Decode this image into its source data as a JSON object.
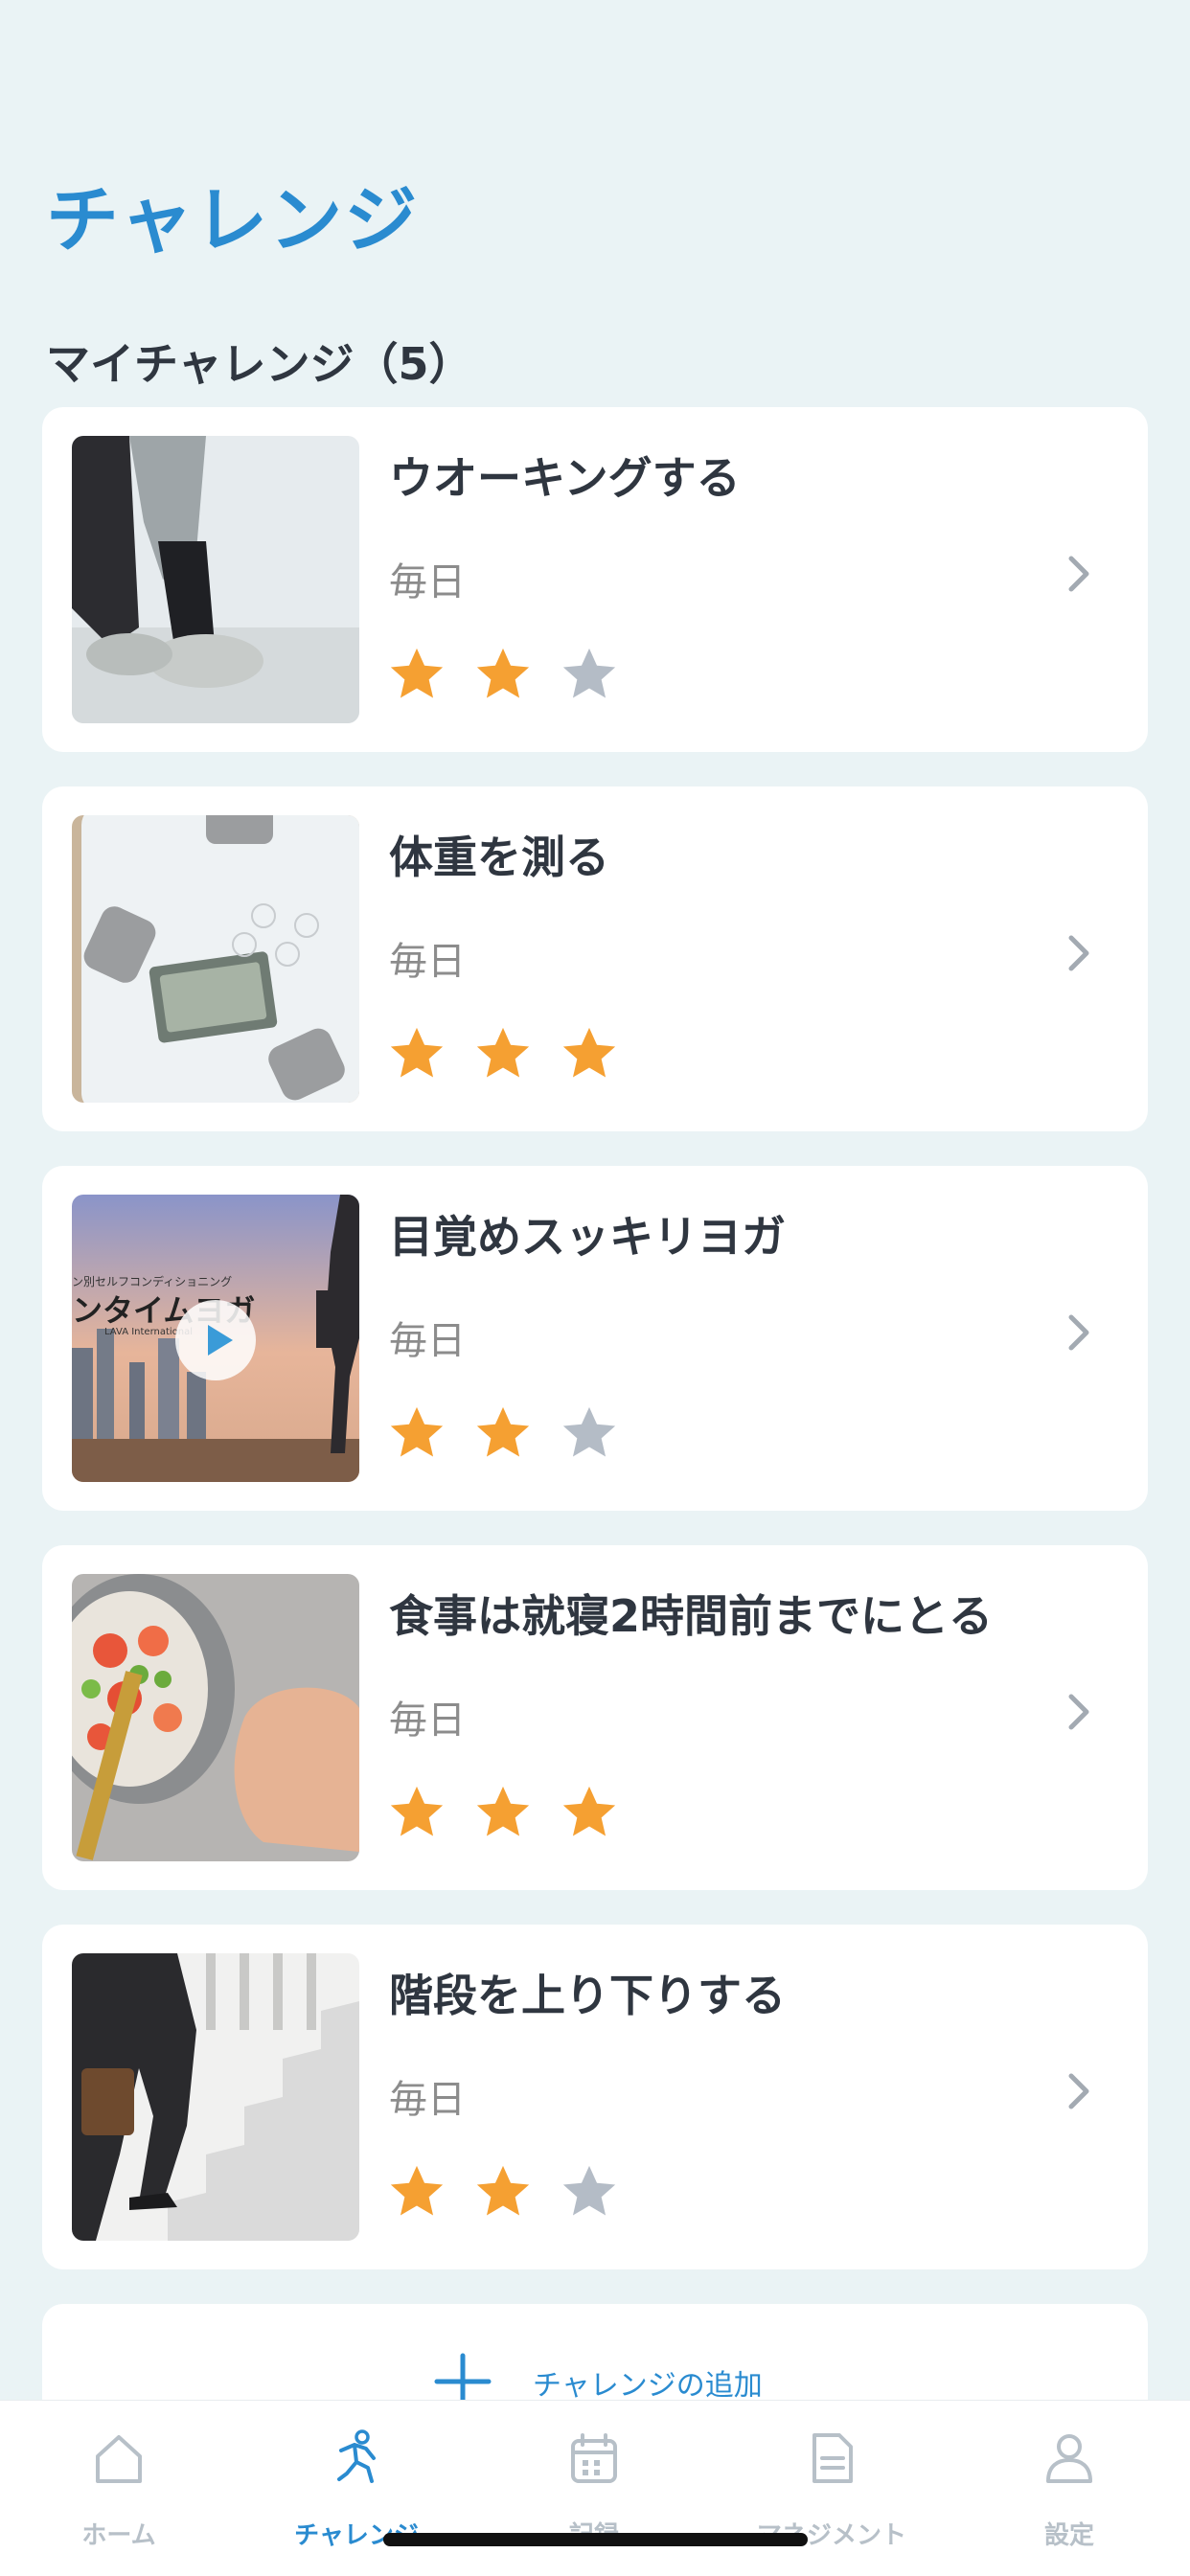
{
  "page": {
    "title": "チャレンジ"
  },
  "section": {
    "title": "マイチャレンジ（5）"
  },
  "challenges": [
    {
      "title": "ウオーキングする",
      "frequency": "毎日",
      "stars_filled": 2,
      "stars_total": 3,
      "thumbnail": "walking-photo"
    },
    {
      "title": "体重を測る",
      "frequency": "毎日",
      "stars_filled": 3,
      "stars_total": 3,
      "thumbnail": "scale-photo"
    },
    {
      "title": "目覚めスッキリヨガ",
      "frequency": "毎日",
      "stars_filled": 2,
      "stars_total": 3,
      "thumbnail": "yoga-video",
      "thumb_text": {
        "line1": "ン別セルフコンディショニング",
        "line2": "ンタイムヨガ",
        "line3": "LAVA International"
      }
    },
    {
      "title": "食事は就寝2時間前までにとる",
      "frequency": "毎日",
      "stars_filled": 3,
      "stars_total": 3,
      "thumbnail": "meal-photo"
    },
    {
      "title": "階段を上り下りする",
      "frequency": "毎日",
      "stars_filled": 2,
      "stars_total": 3,
      "thumbnail": "stairs-photo"
    }
  ],
  "add_button": {
    "label": "チャレンジの追加",
    "icon": "plus-icon"
  },
  "tabs": [
    {
      "label": "ホーム",
      "icon": "home-icon",
      "active": false
    },
    {
      "label": "チャレンジ",
      "icon": "running-person-icon",
      "active": true
    },
    {
      "label": "記録",
      "icon": "calendar-icon",
      "active": false
    },
    {
      "label": "マネジメント",
      "icon": "document-icon",
      "active": false
    },
    {
      "label": "設定",
      "icon": "person-icon",
      "active": false
    }
  ],
  "colors": {
    "accent": "#2a8bd0",
    "star_filled": "#f5a032",
    "star_empty": "#b4bcc6",
    "background": "#eaf3f5"
  }
}
